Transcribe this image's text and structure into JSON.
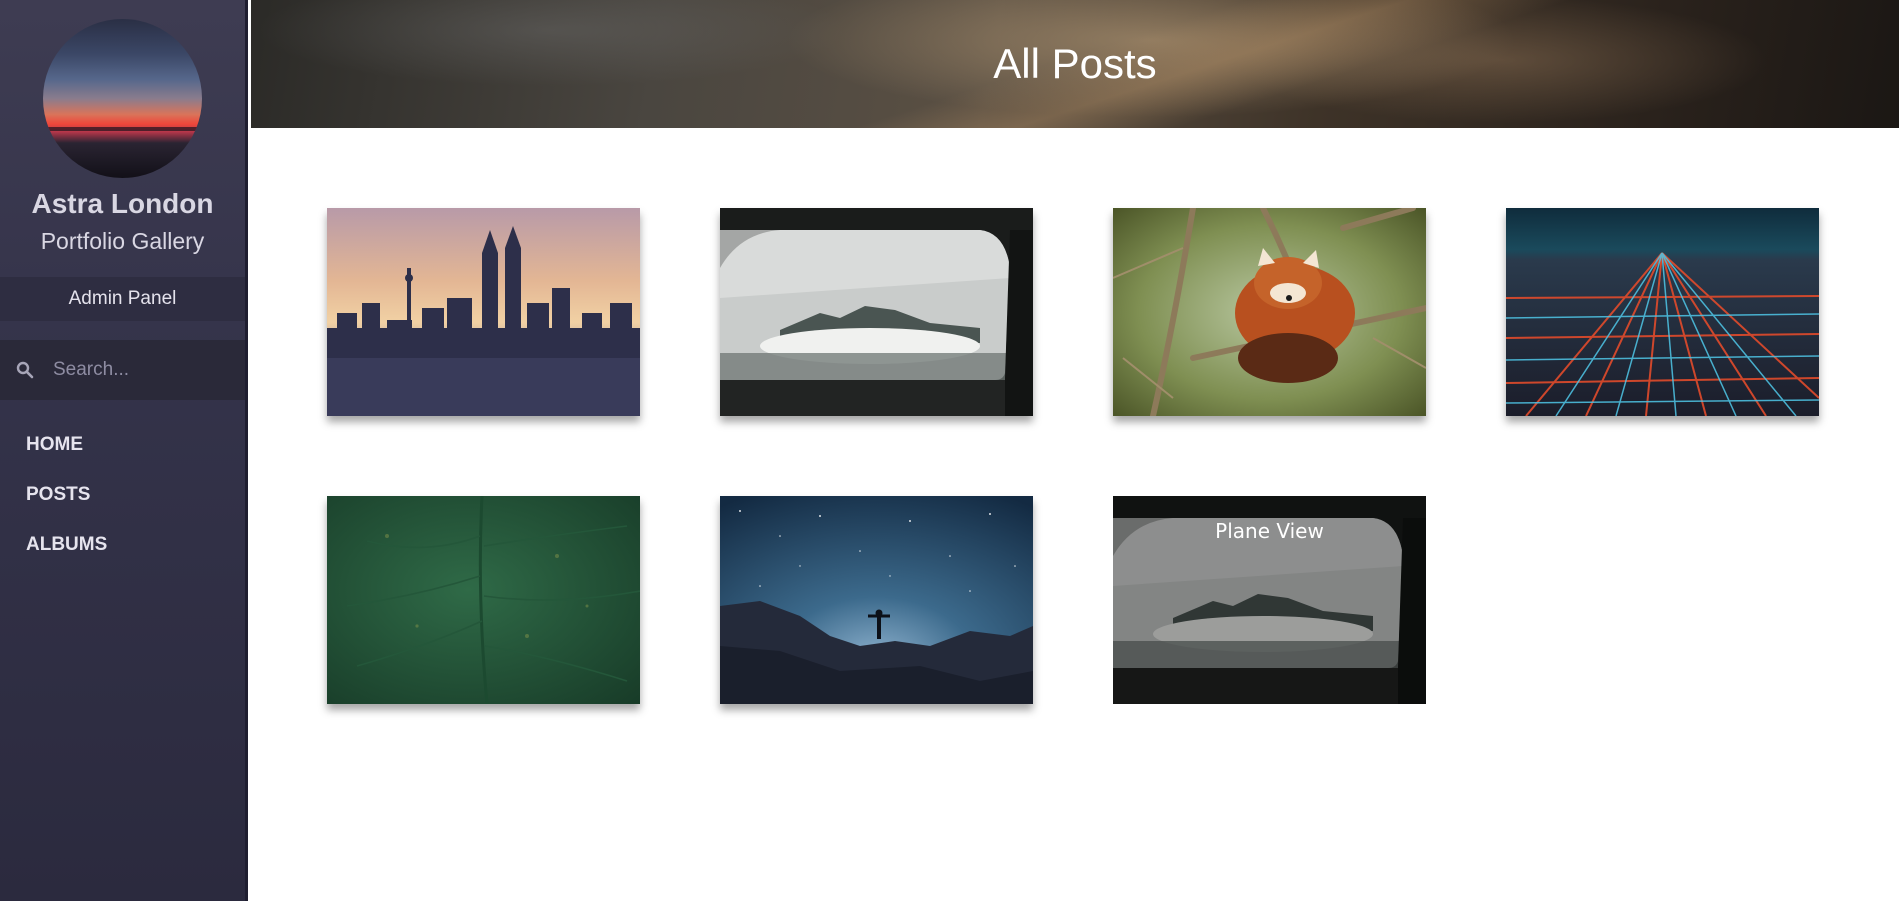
{
  "sidebar": {
    "profile_name": "Astra London",
    "profile_subtitle": "Portfolio Gallery",
    "admin_panel_label": "Admin Panel",
    "search_placeholder": "Search...",
    "nav": [
      {
        "label": "HOME"
      },
      {
        "label": "POSTS"
      },
      {
        "label": "ALBUMS"
      }
    ]
  },
  "header": {
    "title": "All Posts"
  },
  "gallery": {
    "items": [
      {
        "scene": "city-skyline-sunset"
      },
      {
        "scene": "car-window-mountains"
      },
      {
        "scene": "red-panda-on-branch"
      },
      {
        "scene": "city-lights-aerial-night"
      },
      {
        "scene": "green-leaf-closeup"
      },
      {
        "scene": "person-under-starry-sky"
      },
      {
        "scene": "car-window-mountains",
        "hover_title": "Plane View"
      }
    ]
  },
  "colors": {
    "sidebar_bg": "#34334a",
    "sidebar_text": "#d9d7e3",
    "admin_panel_bg": "#2e2d41",
    "search_bg": "#2a2939",
    "page_bg": "#ffffff"
  }
}
